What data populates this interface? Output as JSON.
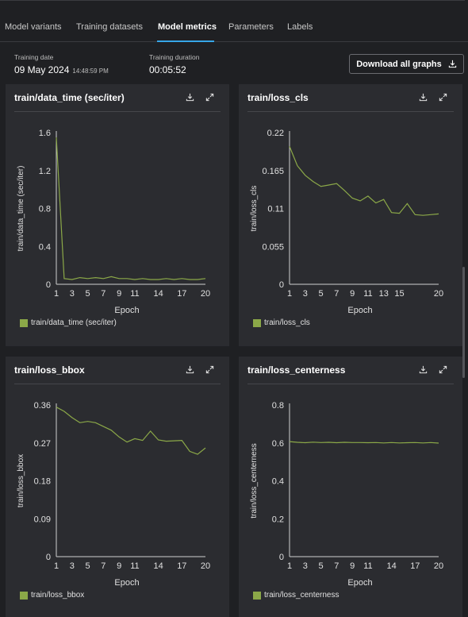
{
  "tabs": [
    {
      "label": "Model variants",
      "active": false
    },
    {
      "label": "Training datasets",
      "active": false
    },
    {
      "label": "Model metrics",
      "active": true
    },
    {
      "label": "Parameters",
      "active": false
    },
    {
      "label": "Labels",
      "active": false
    }
  ],
  "training": {
    "date_label": "Training date",
    "date": "09 May 2024",
    "time": "14:48:59 PM",
    "duration_label": "Training duration",
    "duration": "00:05:52"
  },
  "download_all_label": "Download all graphs",
  "colors": {
    "accent": "#36a6e8",
    "series": "#8ba848",
    "background": "#1f2023",
    "card": "#2b2c30"
  },
  "icons": {
    "download": "download-icon",
    "expand": "expand-icon"
  },
  "chart_data": [
    {
      "type": "line",
      "title": "train/data_time (sec/iter)",
      "xlabel": "Epoch",
      "ylabel": "train/data_time (sec/iter)",
      "xlim": [
        1,
        20
      ],
      "ylim": [
        0,
        1.6
      ],
      "x_ticks": [
        "1",
        "3",
        "5",
        "7",
        "9",
        "11",
        "14",
        "17",
        "20"
      ],
      "y_ticks": [
        "0",
        "0.4",
        "0.8",
        "1.2",
        "1.6"
      ],
      "series": [
        {
          "name": "train/data_time (sec/iter)",
          "x": [
            1,
            2,
            3,
            4,
            5,
            6,
            7,
            8,
            9,
            10,
            11,
            12,
            13,
            14,
            15,
            16,
            17,
            18,
            19,
            20
          ],
          "values": [
            1.55,
            0.06,
            0.05,
            0.07,
            0.06,
            0.07,
            0.06,
            0.08,
            0.06,
            0.06,
            0.05,
            0.06,
            0.05,
            0.05,
            0.06,
            0.05,
            0.06,
            0.05,
            0.05,
            0.06
          ]
        }
      ]
    },
    {
      "type": "line",
      "title": "train/loss_cls",
      "xlabel": "Epoch",
      "ylabel": "train/loss_cls",
      "xlim": [
        1,
        20
      ],
      "ylim": [
        0,
        0.22
      ],
      "x_ticks": [
        "1",
        "3",
        "5",
        "7",
        "9",
        "11",
        "13",
        "15",
        "20"
      ],
      "y_ticks": [
        "0",
        "0.055",
        "0.11",
        "0.165",
        "0.22"
      ],
      "series": [
        {
          "name": "train/loss_cls",
          "x": [
            1,
            2,
            3,
            4,
            5,
            6,
            7,
            8,
            9,
            10,
            11,
            12,
            13,
            14,
            15,
            16,
            17,
            18,
            19,
            20
          ],
          "values": [
            0.2,
            0.172,
            0.158,
            0.149,
            0.142,
            0.144,
            0.146,
            0.136,
            0.125,
            0.121,
            0.128,
            0.118,
            0.123,
            0.104,
            0.103,
            0.117,
            0.101,
            0.1,
            0.101,
            0.102
          ]
        }
      ]
    },
    {
      "type": "line",
      "title": "train/loss_bbox",
      "xlabel": "Epoch",
      "ylabel": "train/loss_bbox",
      "xlim": [
        1,
        20
      ],
      "ylim": [
        0,
        0.36
      ],
      "x_ticks": [
        "1",
        "3",
        "5",
        "7",
        "9",
        "11",
        "14",
        "17",
        "20"
      ],
      "y_ticks": [
        "0",
        "0.09",
        "0.18",
        "0.27",
        "0.36"
      ],
      "series": [
        {
          "name": "train/loss_bbox",
          "x": [
            1,
            2,
            3,
            4,
            5,
            6,
            7,
            8,
            9,
            10,
            11,
            12,
            13,
            14,
            15,
            16,
            17,
            18,
            19,
            20
          ],
          "values": [
            0.355,
            0.345,
            0.33,
            0.318,
            0.321,
            0.318,
            0.309,
            0.3,
            0.284,
            0.272,
            0.28,
            0.276,
            0.298,
            0.277,
            0.274,
            0.275,
            0.276,
            0.25,
            0.243,
            0.258
          ]
        }
      ]
    },
    {
      "type": "line",
      "title": "train/loss_centerness",
      "xlabel": "Epoch",
      "ylabel": "train/loss_centerness",
      "xlim": [
        1,
        20
      ],
      "ylim": [
        0,
        0.8
      ],
      "x_ticks": [
        "1",
        "3",
        "5",
        "7",
        "9",
        "11",
        "14",
        "17",
        "20"
      ],
      "y_ticks": [
        "0",
        "0.2",
        "0.4",
        "0.6",
        "0.8"
      ],
      "series": [
        {
          "name": "train/loss_centerness",
          "x": [
            1,
            2,
            3,
            4,
            5,
            6,
            7,
            8,
            9,
            10,
            11,
            12,
            13,
            14,
            15,
            16,
            17,
            18,
            19,
            20
          ],
          "values": [
            0.607,
            0.603,
            0.601,
            0.604,
            0.602,
            0.603,
            0.601,
            0.603,
            0.602,
            0.602,
            0.601,
            0.602,
            0.6,
            0.602,
            0.6,
            0.601,
            0.602,
            0.6,
            0.602,
            0.599
          ]
        }
      ]
    }
  ]
}
